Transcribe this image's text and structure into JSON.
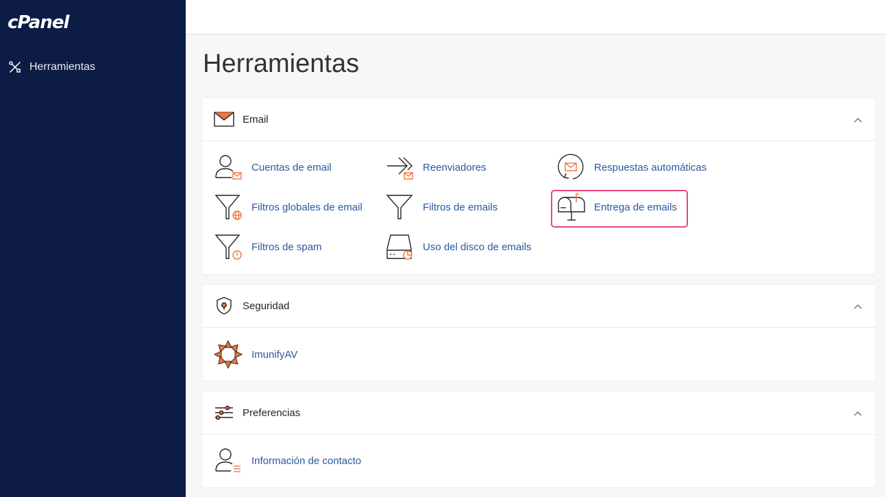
{
  "brand": {
    "logo_text": "cPanel"
  },
  "sidebar": {
    "items": [
      {
        "label": "Herramientas",
        "icon": "tools-icon"
      }
    ]
  },
  "page": {
    "title": "Herramientas"
  },
  "sections": [
    {
      "title": "Email",
      "icon": "envelope-icon",
      "items": [
        {
          "label": "Cuentas de email",
          "icon": "email-accounts-icon"
        },
        {
          "label": "Reenviadores",
          "icon": "forwarders-icon"
        },
        {
          "label": "Respuestas automáticas",
          "icon": "autoresponders-icon"
        },
        {
          "label": "Filtros globales de email",
          "icon": "global-filter-icon"
        },
        {
          "label": "Filtros de emails",
          "icon": "filter-icon"
        },
        {
          "label": "Entrega de emails",
          "icon": "mailbox-icon"
        },
        {
          "label": "Filtros de spam",
          "icon": "spam-filter-icon"
        },
        {
          "label": "Uso del disco de emails",
          "icon": "disk-usage-icon"
        }
      ]
    },
    {
      "title": "Seguridad",
      "icon": "shield-icon",
      "items": [
        {
          "label": "ImunifyAV",
          "icon": "imunify-icon"
        }
      ]
    },
    {
      "title": "Preferencias",
      "icon": "sliders-icon",
      "items": [
        {
          "label": "Información de contacto",
          "icon": "contact-info-icon"
        }
      ]
    }
  ],
  "colors": {
    "sidebar_bg": "#0c1c44",
    "accent_orange": "#f0733a",
    "link_blue": "#2a57a0",
    "highlight_pink": "#e5467a"
  }
}
